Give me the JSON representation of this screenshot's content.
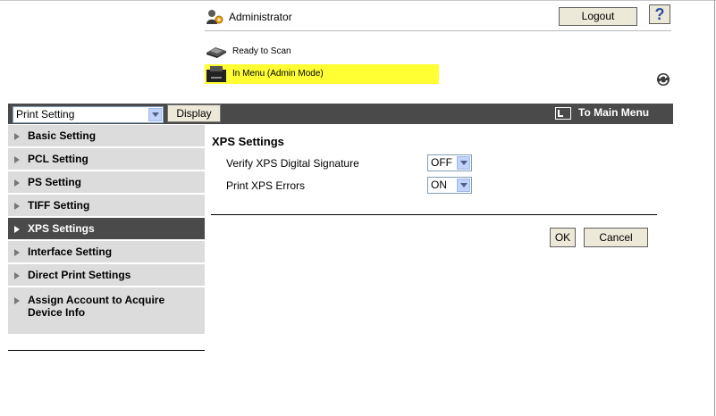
{
  "header": {
    "user_label": "Administrator",
    "logout_label": "Logout",
    "help_label": "?",
    "status_ready": "Ready to Scan",
    "status_mode": "In Menu (Admin Mode)"
  },
  "toolbar": {
    "mode_select_value": "Print Setting",
    "display_label": "Display",
    "main_menu_label": "To Main Menu"
  },
  "sidebar": {
    "items": [
      {
        "label": "Basic Setting",
        "active": false
      },
      {
        "label": "PCL Setting",
        "active": false
      },
      {
        "label": "PS Setting",
        "active": false
      },
      {
        "label": "TIFF Setting",
        "active": false
      },
      {
        "label": "XPS Settings",
        "active": true
      },
      {
        "label": "Interface Setting",
        "active": false
      },
      {
        "label": "Direct Print Settings",
        "active": false
      },
      {
        "label": "Assign Account to Acquire Device Info",
        "active": false
      }
    ]
  },
  "main": {
    "title": "XPS Settings",
    "fields": [
      {
        "label": "Verify XPS Digital Signature",
        "value": "OFF"
      },
      {
        "label": "Print XPS Errors",
        "value": "ON"
      }
    ],
    "ok_label": "OK",
    "cancel_label": "Cancel"
  },
  "colors": {
    "toolbar_bg": "#4a4a4a",
    "status_highlight": "#ffff33",
    "sidebar_bg": "#dcdcdc",
    "button_bg": "#ece9d8"
  }
}
